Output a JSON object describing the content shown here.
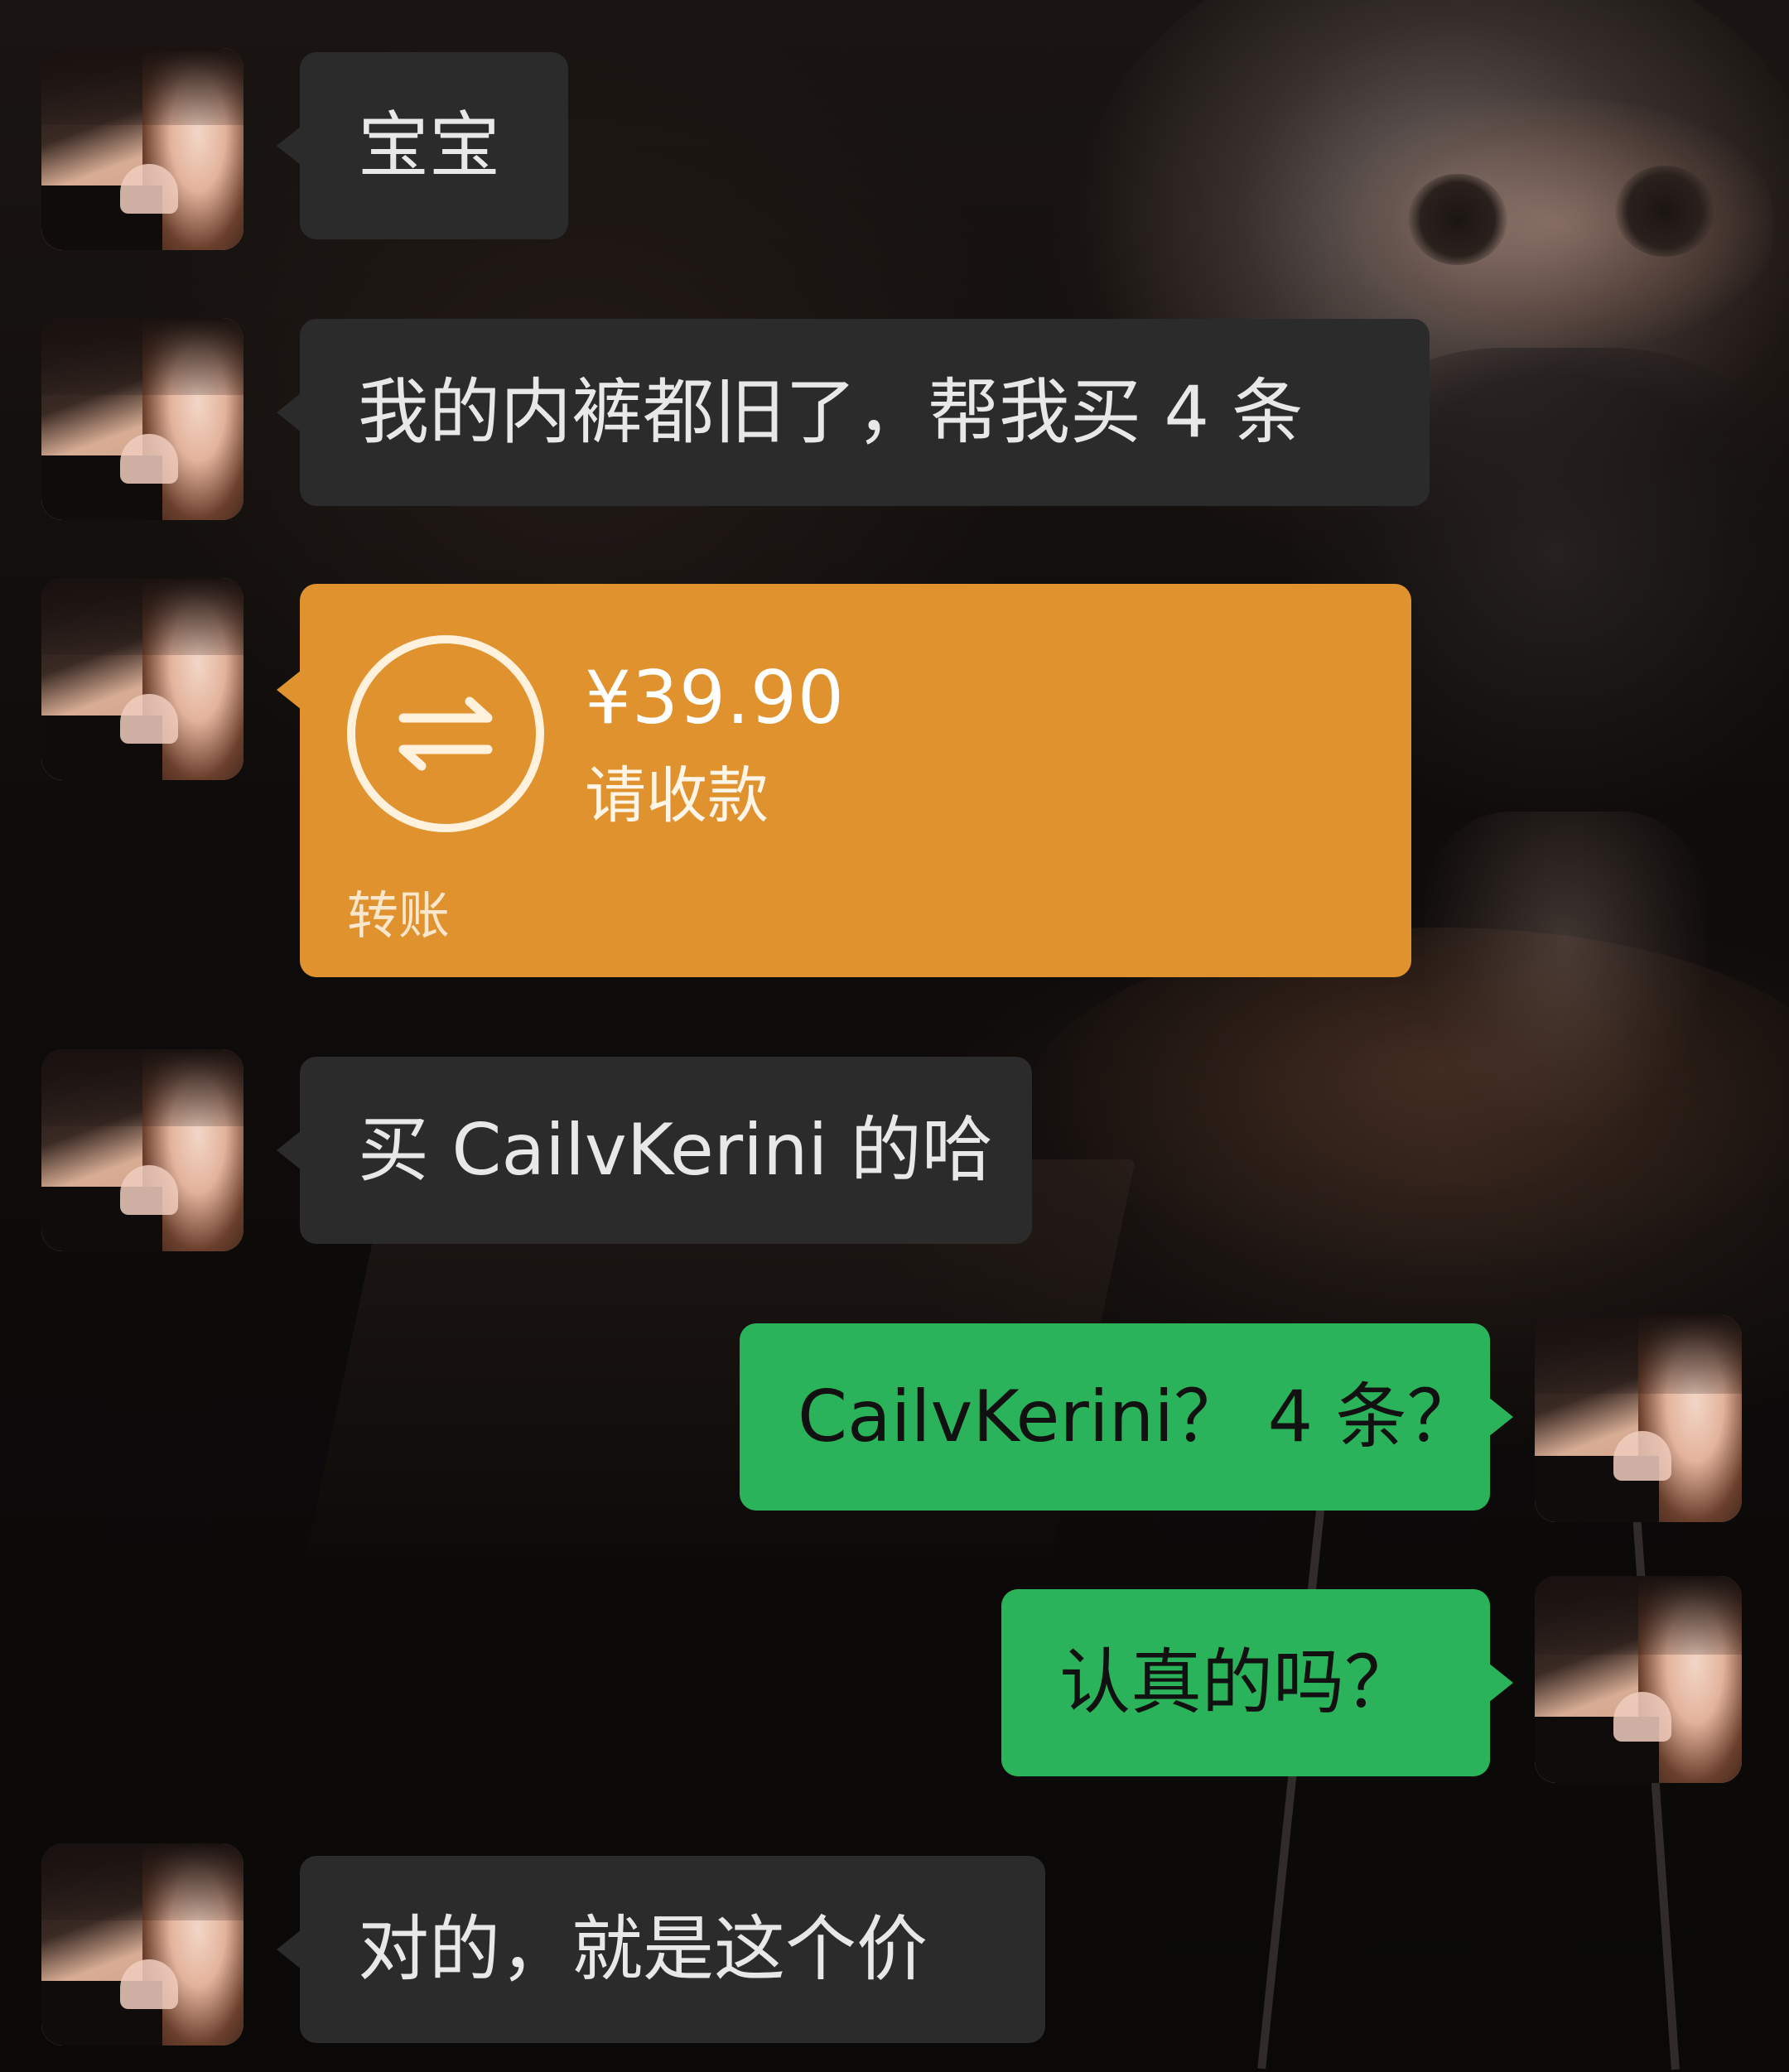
{
  "messages": [
    {
      "side": "incoming",
      "text": "宝宝"
    },
    {
      "side": "incoming",
      "text": "我的内裤都旧了，帮我买 4 条"
    },
    {
      "side": "incoming",
      "type": "transfer",
      "amount": "¥39.90",
      "status": "请收款",
      "label": "转账"
    },
    {
      "side": "incoming",
      "text": "买 CailvKerini 的哈"
    },
    {
      "side": "outgoing",
      "text": "CailvKerini？ 4 条？"
    },
    {
      "side": "outgoing",
      "text": "认真的吗？"
    },
    {
      "side": "incoming",
      "text": "对的，就是这个价"
    }
  ],
  "colors": {
    "incoming_bubble": "#2b2b2b",
    "outgoing_bubble": "#2bb35b",
    "transfer_card": "#e0922f"
  },
  "icons": {
    "transfer": "transfer-arrows-icon"
  }
}
